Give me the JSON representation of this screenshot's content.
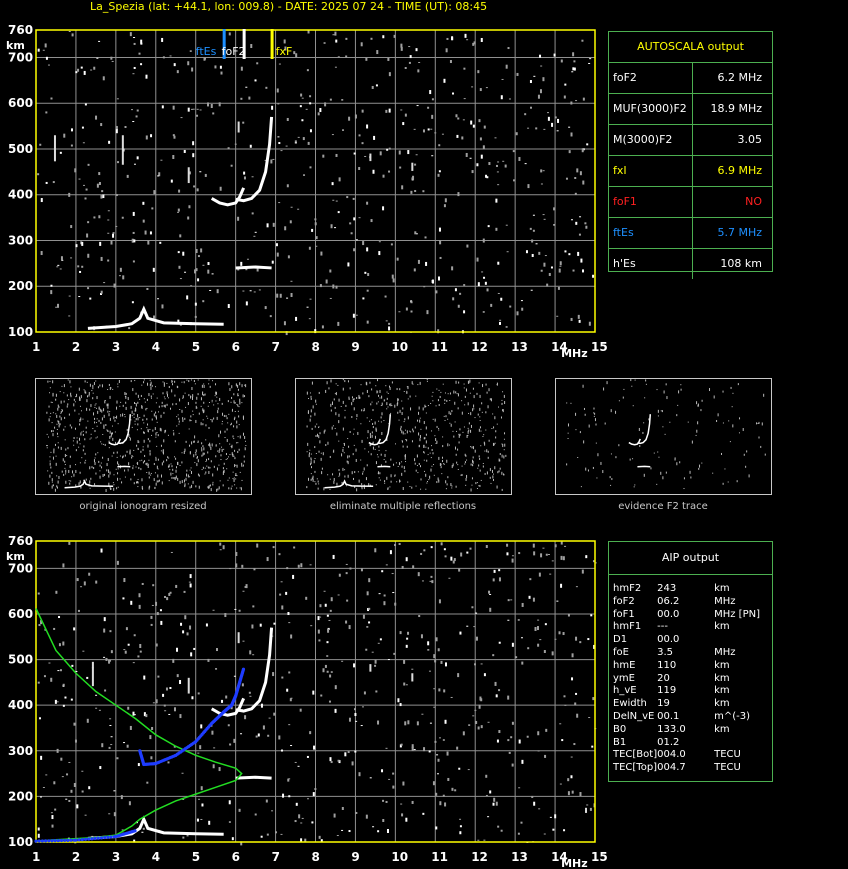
{
  "header": {
    "title": "La_Spezia (lat: +44.1, lon: 009.8) - DATE: 2025 07 24 - TIME (UT): 08:45"
  },
  "colors": {
    "frame": "#ffff00",
    "grid": "#909090",
    "trace": "#ffffff",
    "noise": "#a0a0a0",
    "panel_border": "#4caf50",
    "fxF_marker": "#ffff00",
    "ftEs_marker": "#1e90ff",
    "profile": "#22dd22",
    "aip_points": "#1e3cff"
  },
  "chart_data": [
    {
      "type": "scatter",
      "name_in_image": "",
      "xlabel": "MHz",
      "ylabel": "km",
      "xlim": [
        1,
        15
      ],
      "ylim": [
        100,
        760
      ],
      "x_ticks": [
        "1",
        "2",
        "3",
        "4",
        "5",
        "6",
        "7",
        "8",
        "9",
        "10",
        "11",
        "12",
        "13",
        "14",
        "15"
      ],
      "y_ticks": [
        "100",
        "200",
        "300",
        "400",
        "500",
        "600",
        "700",
        "760"
      ],
      "grid": true,
      "markers": [
        {
          "label": "ftEs",
          "x": 5.7
        },
        {
          "label": "foF2",
          "x": 6.2
        },
        {
          "label": "fxF",
          "x": 6.9
        }
      ],
      "traces": {
        "es_trace": [
          [
            2.3,
            108
          ],
          [
            3.0,
            112
          ],
          [
            3.4,
            118
          ],
          [
            3.6,
            130
          ],
          [
            3.7,
            150
          ],
          [
            3.8,
            130
          ],
          [
            4.2,
            120
          ],
          [
            5.0,
            118
          ],
          [
            5.7,
            117
          ]
        ],
        "f2_o_trace": [
          [
            5.4,
            392
          ],
          [
            5.6,
            382
          ],
          [
            5.8,
            378
          ],
          [
            6.0,
            382
          ],
          [
            6.1,
            395
          ],
          [
            6.2,
            415
          ]
        ],
        "f2_x_trace": [
          [
            6.0,
            390
          ],
          [
            6.2,
            387
          ],
          [
            6.4,
            392
          ],
          [
            6.6,
            410
          ],
          [
            6.75,
            450
          ],
          [
            6.85,
            510
          ],
          [
            6.9,
            570
          ]
        ],
        "f_low": [
          [
            6.0,
            240
          ],
          [
            6.5,
            242
          ],
          [
            6.9,
            240
          ]
        ]
      }
    },
    {
      "type": "scatter",
      "name_in_image": "",
      "xlabel": "MHz",
      "ylabel": "km",
      "xlim": [
        1,
        15
      ],
      "ylim": [
        100,
        760
      ],
      "x_ticks": [
        "1",
        "2",
        "3",
        "4",
        "5",
        "6",
        "7",
        "8",
        "9",
        "10",
        "11",
        "12",
        "13",
        "14",
        "15"
      ],
      "y_ticks": [
        "100",
        "200",
        "300",
        "400",
        "500",
        "600",
        "700",
        "760"
      ],
      "grid": true,
      "profile": [
        [
          1.0,
          612
        ],
        [
          1.5,
          520
        ],
        [
          2.0,
          470
        ],
        [
          2.5,
          430
        ],
        [
          3.0,
          400
        ],
        [
          3.5,
          370
        ],
        [
          4.0,
          335
        ],
        [
          4.5,
          310
        ],
        [
          5.0,
          290
        ],
        [
          5.5,
          275
        ],
        [
          6.0,
          262
        ],
        [
          6.15,
          250
        ],
        [
          6.0,
          235
        ],
        [
          5.5,
          220
        ],
        [
          5.0,
          205
        ],
        [
          4.5,
          190
        ],
        [
          4.0,
          170
        ],
        [
          3.6,
          150
        ],
        [
          3.4,
          135
        ],
        [
          3.0,
          115
        ],
        [
          2.5,
          110
        ],
        [
          1.5,
          105
        ],
        [
          1.0,
          102
        ]
      ],
      "aip_points": [
        [
          3.6,
          300
        ],
        [
          3.7,
          270
        ],
        [
          4.0,
          272
        ],
        [
          4.5,
          290
        ],
        [
          5.0,
          320
        ],
        [
          5.4,
          360
        ],
        [
          5.7,
          385
        ],
        [
          5.9,
          400
        ],
        [
          6.0,
          420
        ],
        [
          6.1,
          450
        ],
        [
          6.2,
          480
        ],
        [
          1.0,
          102
        ],
        [
          2.0,
          104
        ],
        [
          3.0,
          112
        ],
        [
          3.5,
          125
        ]
      ]
    }
  ],
  "autoscala": {
    "title": "AUTOSCALA output",
    "rows": [
      {
        "key": "foF2",
        "value": "6.2 MHz",
        "key_color": "#ffffff",
        "value_color": "#ffffff"
      },
      {
        "key": "MUF(3000)F2",
        "value": "18.9 MHz",
        "key_color": "#ffffff",
        "value_color": "#ffffff"
      },
      {
        "key": "M(3000)F2",
        "value": "3.05",
        "key_color": "#ffffff",
        "value_color": "#ffffff"
      },
      {
        "key": "fxI",
        "value": "6.9 MHz",
        "key_color": "#ffff00",
        "value_color": "#ffff00"
      },
      {
        "key": "foF1",
        "value": "NO",
        "key_color": "#ff2020",
        "value_color": "#ff2020"
      },
      {
        "key": "ftEs",
        "value": "5.7 MHz",
        "key_color": "#1e90ff",
        "value_color": "#1e90ff"
      },
      {
        "key": "h'Es",
        "value": "108     km",
        "key_color": "#ffffff",
        "value_color": "#ffffff"
      }
    ]
  },
  "aip": {
    "title": "AIP output",
    "rows": [
      {
        "k": "hmF2",
        "v": "243",
        "u": "km"
      },
      {
        "k": "foF2",
        "v": "06.2",
        "u": "MHz"
      },
      {
        "k": "foF1",
        "v": "00.0",
        "u": "MHz   [PN]"
      },
      {
        "k": "hmF1",
        "v": "---",
        "u": "km"
      },
      {
        "k": "D1",
        "v": "00.0",
        "u": ""
      },
      {
        "k": "foE",
        "v": "3.5",
        "u": "MHz"
      },
      {
        "k": "hmE",
        "v": "110",
        "u": "km"
      },
      {
        "k": "ymE",
        "v": "20",
        "u": "km"
      },
      {
        "k": "h_vE",
        "v": "119",
        "u": "km"
      },
      {
        "k": "Ewidth",
        "v": "19",
        "u": "km"
      },
      {
        "k": "DelN_vE",
        "v": "00.1",
        "u": "m^(-3)"
      },
      {
        "k": "B0",
        "v": "133.0",
        "u": "km"
      },
      {
        "k": "B1",
        "v": "01.2",
        "u": ""
      },
      {
        "k": "TEC[Bot]",
        "v": "004.0",
        "u": "TECU"
      },
      {
        "k": "TEC[Top]",
        "v": "004.7",
        "u": "TECU"
      }
    ]
  },
  "thumbnails": [
    {
      "caption": "original ionogram resized"
    },
    {
      "caption": "eliminate multiple reflections"
    },
    {
      "caption": "evidence F2 trace"
    }
  ]
}
